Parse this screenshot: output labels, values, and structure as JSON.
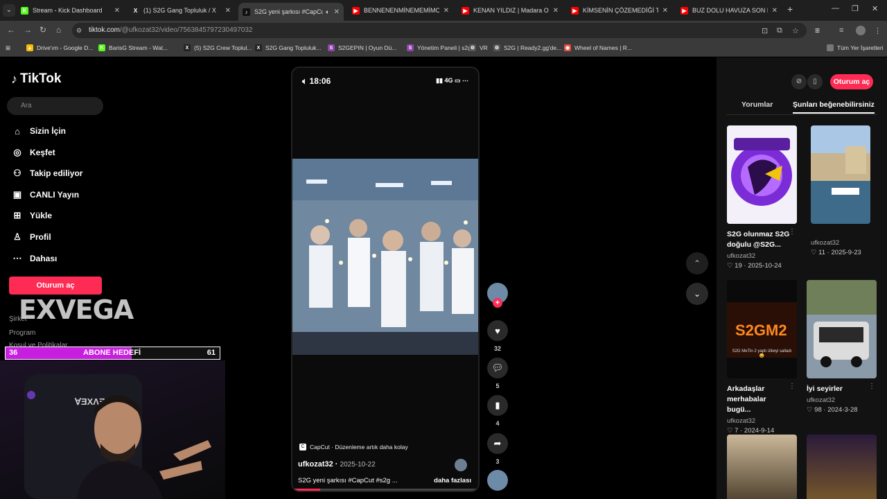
{
  "browser": {
    "tabs": [
      {
        "title": "Stream - Kick Dashboard",
        "favicon_color": "#53fc18",
        "favicon_glyph": "K",
        "active": false
      },
      {
        "title": "(1) S2G Gang Topluluk / X",
        "favicon_color": "#222222",
        "favicon_glyph": "X",
        "active": false
      },
      {
        "title": "S2G yeni şarkısı #CapCut #",
        "favicon_color": "#111111",
        "favicon_glyph": "♪",
        "active": true
      },
      {
        "title": "BENNENENMİNEMEMİMOMAN",
        "favicon_color": "#ff0000",
        "favicon_glyph": "▶",
        "active": false
      },
      {
        "title": "KENAN YILDIZ | Madara Olduk",
        "favicon_color": "#ff0000",
        "favicon_glyph": "▶",
        "active": false
      },
      {
        "title": "KİMSENİN ÇÖZEMEDİĞİ TARİH",
        "favicon_color": "#ff0000",
        "favicon_glyph": "▶",
        "active": false
      },
      {
        "title": "BUZ DOLU HAVUZA SON DÜŞE",
        "favicon_color": "#ff0000",
        "favicon_glyph": "▶",
        "active": false
      }
    ],
    "url_host": "tiktok.com",
    "url_path": "/@ufkozat32/video/7563845797230497032",
    "bookmarks": [
      {
        "label": "Drive'ım - Google D...",
        "color": "#fbbc04",
        "glyph": "▲"
      },
      {
        "label": "BarisG Stream - Wat...",
        "color": "#53fc18",
        "glyph": "K"
      },
      {
        "label": "(5) S2G Crew Toplul...",
        "color": "#222222",
        "glyph": "X"
      },
      {
        "label": "S2G Gang Topluluk...",
        "color": "#222222",
        "glyph": "X"
      },
      {
        "label": "S2GEPIN | Oyun Dü...",
        "color": "#8e44ad",
        "glyph": "S"
      },
      {
        "label": "Yönetim Paneli | s2g...",
        "color": "#8e44ad",
        "glyph": "S"
      },
      {
        "label": "VR",
        "color": "#555555",
        "glyph": "⚙"
      },
      {
        "label": "S2G | Ready2.gg'de...",
        "color": "#555555",
        "glyph": "⚙"
      },
      {
        "label": "Wheel of Names | R...",
        "color": "#e74c3c",
        "glyph": "◉"
      }
    ],
    "all_bookmarks": "Tüm Yer İşaretleri"
  },
  "sidebar": {
    "logo": "TikTok",
    "search_placeholder": "Ara",
    "items": [
      {
        "label": "Sizin İçin",
        "icon": "⌂",
        "icon_name": "home-icon"
      },
      {
        "label": "Keşfet",
        "icon": "◎",
        "icon_name": "compass-icon"
      },
      {
        "label": "Takip ediliyor",
        "icon": "⚇",
        "icon_name": "following-icon"
      },
      {
        "label": "CANLI Yayın",
        "icon": "▣",
        "icon_name": "live-icon"
      },
      {
        "label": "Yükle",
        "icon": "⊞",
        "icon_name": "upload-icon"
      },
      {
        "label": "Profil",
        "icon": "♙",
        "icon_name": "profile-icon"
      },
      {
        "label": "Dahası",
        "icon": "⋯",
        "icon_name": "more-icon"
      }
    ],
    "login_label": "Oturum aç",
    "footer": [
      "Şirket",
      "Program",
      "Koşul ve Politikalar"
    ]
  },
  "stream_overlay": {
    "brand": "EXVEGA",
    "goal_current": "36",
    "goal_label": "ABONE HEDEFİ",
    "goal_target": "61",
    "goal_fraction": 0.59
  },
  "video": {
    "time": "18:06",
    "network": "4G",
    "capcut_label": "CapCut · Düzenleme artık daha kolay",
    "author": "ufkozat32",
    "date": "2025-10-22",
    "caption": "S2G yeni şarkısı #CapCut #s2g ...",
    "more_label": "daha fazlası",
    "progress_fraction": 0.15
  },
  "actions": {
    "likes": "32",
    "comments": "5",
    "saves": "4",
    "shares": "3"
  },
  "right_panel": {
    "login_label": "Oturum aç",
    "tabs": [
      "Yorumlar",
      "Şunları beğenebilirsiniz"
    ],
    "cards": [
      {
        "title": "S2G olunmaz S2G doğulu @S2G...",
        "user": "ufkozat32",
        "likes": "19",
        "date": "2025-10-24"
      },
      {
        "title": "",
        "user": "ufkozat32",
        "likes": "11",
        "date": "2025-9-23"
      },
      {
        "title": "Arkadaşlar merhabalar bugü...",
        "user": "ufkozat32",
        "likes": "7",
        "date": "2024-9-14"
      },
      {
        "title": "İyi seyirler",
        "user": "ufkozat32",
        "likes": "98",
        "date": "2024-3-28"
      }
    ],
    "thumb2_text": "S2G MeTin 2 yaptı ülkeyi salladı 😄"
  }
}
